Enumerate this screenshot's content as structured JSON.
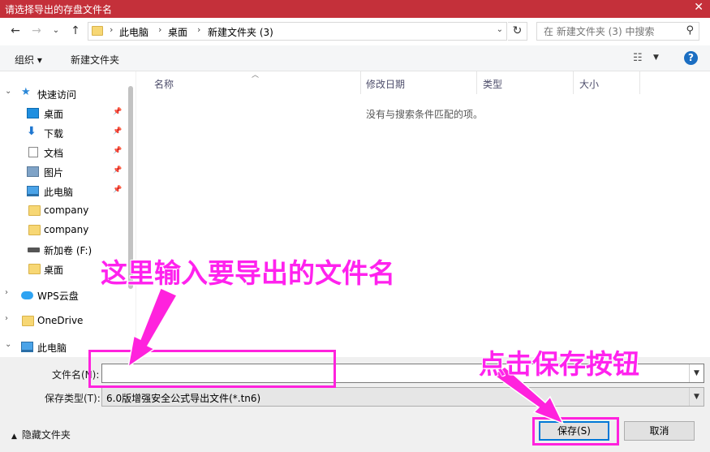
{
  "window": {
    "title": "请选择导出的存盘文件名",
    "close_glyph": "✕"
  },
  "nav": {
    "back": "←",
    "forward": "→",
    "recent": "⌄",
    "up": "↑",
    "breadcrumb": [
      "此电脑",
      "桌面",
      "新建文件夹 (3)"
    ],
    "refresh": "↻",
    "search_placeholder": "在 新建文件夹 (3) 中搜索",
    "search_icon": "search-icon"
  },
  "toolbar": {
    "organize": "组织 ▾",
    "new_folder": "新建文件夹",
    "help": "?"
  },
  "sidebar": {
    "quick_access": "快速访问",
    "items": [
      {
        "label": "桌面",
        "icon": "desktop-icon",
        "pinned": true
      },
      {
        "label": "下载",
        "icon": "download-icon",
        "pinned": true
      },
      {
        "label": "文档",
        "icon": "document-icon",
        "pinned": true
      },
      {
        "label": "图片",
        "icon": "picture-icon",
        "pinned": true
      },
      {
        "label": "此电脑",
        "icon": "computer-icon",
        "pinned": true
      },
      {
        "label": "company",
        "icon": "folder-icon",
        "pinned": false
      },
      {
        "label": "company",
        "icon": "folder-icon",
        "pinned": false
      },
      {
        "label": "新加卷 (F:)",
        "icon": "drive-icon",
        "pinned": false
      },
      {
        "label": "桌面",
        "icon": "folder-icon",
        "pinned": false
      }
    ],
    "wps": "WPS云盘",
    "onedrive": "OneDrive",
    "this_pc": "此电脑"
  },
  "columns": {
    "name": "名称",
    "modified": "修改日期",
    "type": "类型",
    "size": "大小"
  },
  "empty_message": "没有与搜索条件匹配的项。",
  "bottom": {
    "filename_label": "文件名(N):",
    "filename_value": "",
    "filetype_label": "保存类型(T):",
    "filetype_value": "6.0版增强安全公式导出文件(*.tn6)",
    "hide_folders": "隐藏文件夹",
    "save": "保存(S)",
    "cancel": "取消"
  },
  "annotations": {
    "filename_hint": "这里输入要导出的文件名",
    "save_hint": "点击保存按钮",
    "color": "#ff22dd"
  }
}
